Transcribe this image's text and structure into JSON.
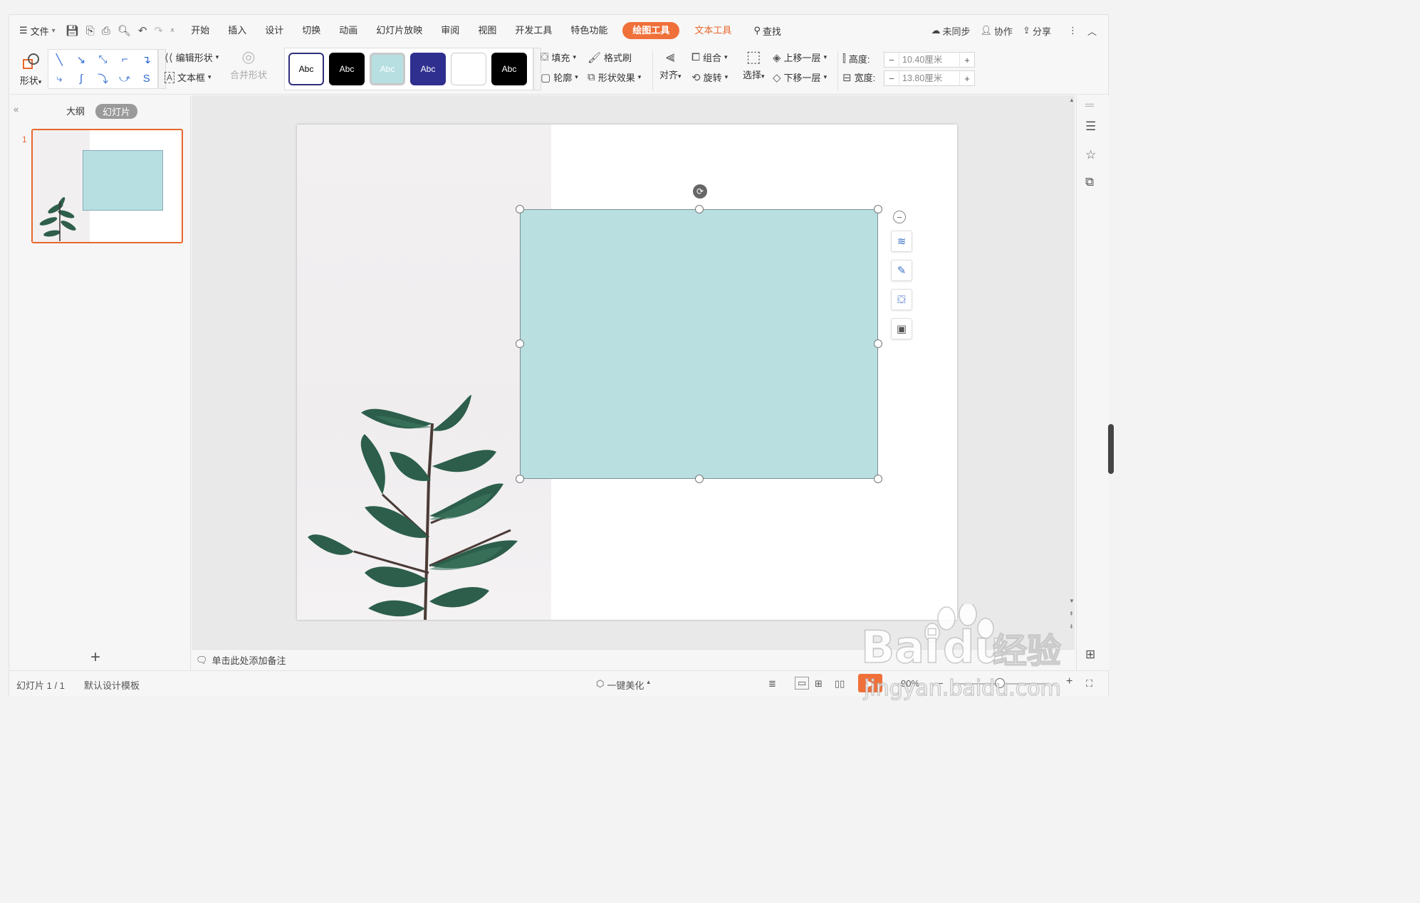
{
  "menubar": {
    "file_label": "文件",
    "tabs": [
      "开始",
      "插入",
      "设计",
      "切换",
      "动画",
      "幻灯片放映",
      "审阅",
      "视图",
      "开发工具",
      "特色功能"
    ],
    "context_tab_drawing": "绘图工具",
    "context_tab_text": "文本工具",
    "search_label": "查找",
    "sync_label": "未同步",
    "collab_label": "协作",
    "share_label": "分享"
  },
  "ribbon": {
    "shape_label": "形状",
    "edit_shape_label": "编辑形状",
    "textbox_label": "文本框",
    "merge_shape_label": "合并形状",
    "style_samples": [
      "Abc",
      "Abc",
      "Abc",
      "Abc",
      "",
      "Abc"
    ],
    "fill_label": "填充",
    "format_painter_label": "格式刷",
    "outline_label": "轮廓",
    "shape_effect_label": "形状效果",
    "align_label": "对齐",
    "group_label": "组合",
    "rotate_label": "旋转",
    "select_label": "选择",
    "bring_forward_label": "上移一层",
    "send_backward_label": "下移一层",
    "height_label": "高度:",
    "height_value": "10.40厘米",
    "width_label": "宽度:",
    "width_value": "13.80厘米",
    "minus": "−",
    "plus": "+"
  },
  "left_panel": {
    "outline_tab": "大纲",
    "slides_tab": "幻灯片",
    "slide_number": "1",
    "add_icon": "+"
  },
  "notes": {
    "placeholder": "单击此处添加备注"
  },
  "status": {
    "slide_info": "幻灯片 1 / 1",
    "template": "默认设计模板",
    "beautify": "一键美化",
    "zoom": "90%"
  },
  "colors": {
    "accent": "#f0703a",
    "shape_fill": "#b9dfe1",
    "selection_orange": "#e8672b"
  }
}
